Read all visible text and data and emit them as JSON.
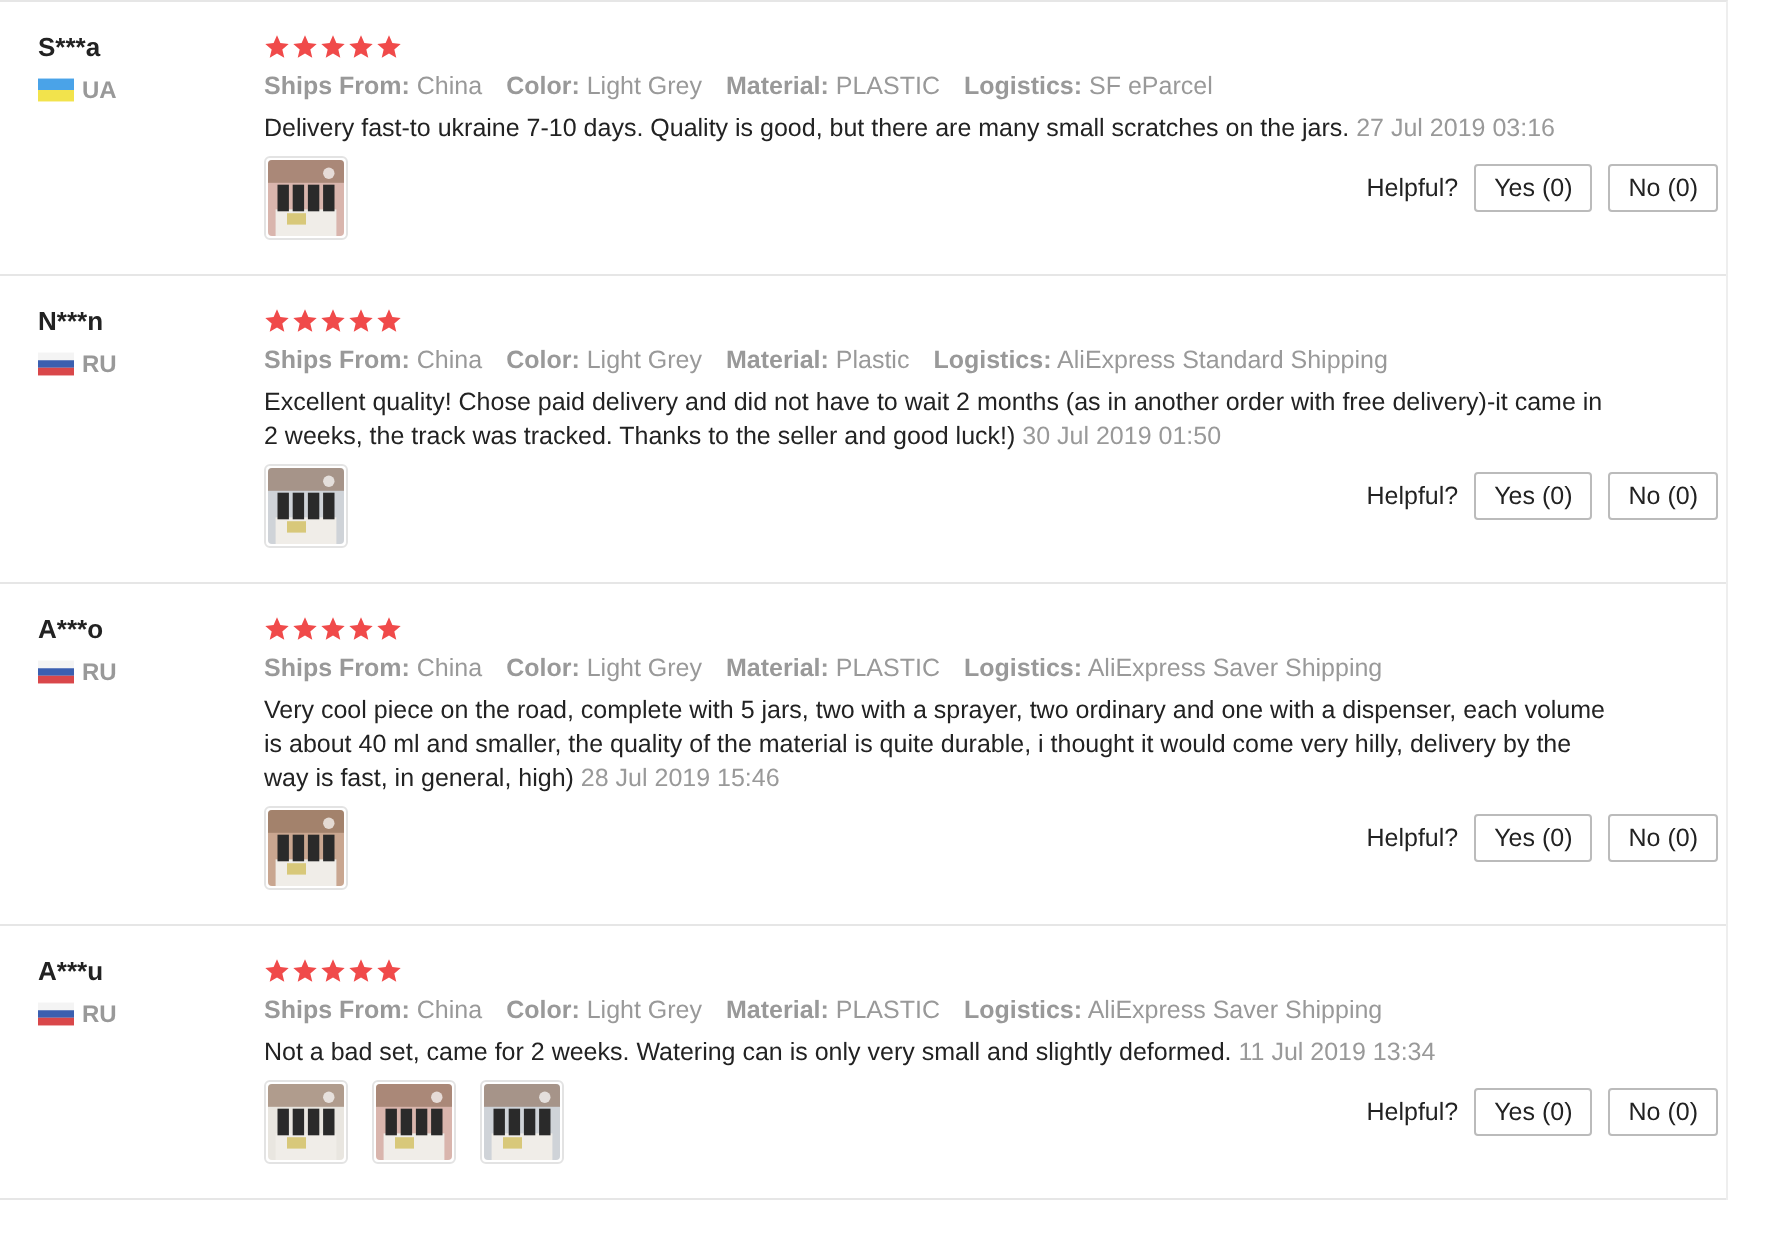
{
  "reviews": [
    {
      "name": "S***a",
      "flag": {
        "kind": "ua"
      },
      "country": "UA",
      "stars": 5,
      "meta": [
        {
          "label": "Ships From:",
          "value": "China"
        },
        {
          "label": "Color:",
          "value": "Light Grey"
        },
        {
          "label": "Material:",
          "value": "PLASTIC"
        },
        {
          "label": "Logistics:",
          "value": "SF eParcel"
        }
      ],
      "text": "Delivery fast-to ukraine 7-10 days. Quality is good, but there are many small scratches on the jars.",
      "date": "27 Jul 2019 03:16",
      "photos": [
        {
          "kind": "picture"
        }
      ],
      "helpful": "Helpful?",
      "yes": "Yes (0)",
      "no": "No (0)"
    },
    {
      "name": "N***n",
      "flag": {
        "kind": "ru"
      },
      "country": "RU",
      "stars": 5,
      "meta": [
        {
          "label": "Ships From:",
          "value": "China"
        },
        {
          "label": "Color:",
          "value": "Light Grey"
        },
        {
          "label": "Material:",
          "value": "Plastic"
        },
        {
          "label": "Logistics:",
          "value": "AliExpress Standard Shipping"
        }
      ],
      "text": "Excellent quality! Chose paid delivery and did not have to wait 2 months (as in another order with free delivery)-it came in 2 weeks, the track was tracked. Thanks to the seller and good luck!)",
      "date": "30 Jul 2019 01:50",
      "photos": [
        {
          "kind": "picture"
        }
      ],
      "helpful": "Helpful?",
      "yes": "Yes (0)",
      "no": "No (0)"
    },
    {
      "name": "A***o",
      "flag": {
        "kind": "ru"
      },
      "country": "RU",
      "stars": 5,
      "meta": [
        {
          "label": "Ships From:",
          "value": "China"
        },
        {
          "label": "Color:",
          "value": "Light Grey"
        },
        {
          "label": "Material:",
          "value": "PLASTIC"
        },
        {
          "label": "Logistics:",
          "value": "AliExpress Saver Shipping"
        }
      ],
      "text": "Very cool piece on the road, complete with 5 jars, two with a sprayer, two ordinary and one with a dispenser, each volume is about 40 ml and smaller, the quality of the material is quite durable, i thought it would come very hilly, delivery by the way is fast, in general, high)",
      "date": "28 Jul 2019 15:46",
      "photos": [
        {
          "kind": "picture"
        }
      ],
      "helpful": "Helpful?",
      "yes": "Yes (0)",
      "no": "No (0)"
    },
    {
      "name": "A***u",
      "flag": {
        "kind": "ru"
      },
      "country": "RU",
      "stars": 5,
      "meta": [
        {
          "label": "Ships From:",
          "value": "China"
        },
        {
          "label": "Color:",
          "value": "Light Grey"
        },
        {
          "label": "Material:",
          "value": "PLASTIC"
        },
        {
          "label": "Logistics:",
          "value": "AliExpress Saver Shipping"
        }
      ],
      "text": "Not a bad set, came for 2 weeks. Watering can is only very small and slightly deformed.",
      "date": "11 Jul 2019 13:34",
      "photos": [
        {
          "kind": "picture"
        },
        {
          "kind": "picture"
        },
        {
          "kind": "picture"
        }
      ],
      "helpful": "Helpful?",
      "yes": "Yes (0)",
      "no": "No (0)"
    }
  ]
}
